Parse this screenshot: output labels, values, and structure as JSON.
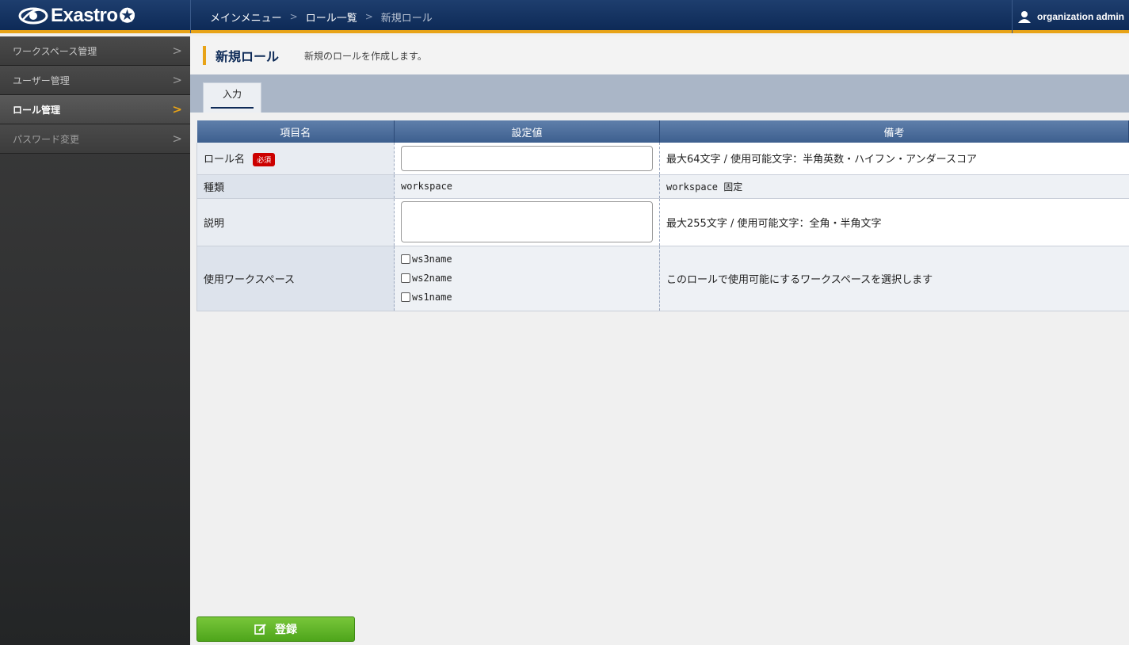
{
  "header": {
    "logo_text": "Exastro",
    "breadcrumb": [
      "メインメニュー",
      "ロール一覧",
      "新規ロール"
    ],
    "user_name": "organization admin"
  },
  "sidebar": {
    "items": [
      {
        "label": "ワークスペース管理",
        "state": "normal"
      },
      {
        "label": "ユーザー管理",
        "state": "normal"
      },
      {
        "label": "ロール管理",
        "state": "active"
      },
      {
        "label": "パスワード変更",
        "state": "disabled"
      }
    ]
  },
  "page": {
    "title": "新規ロール",
    "description": "新規のロールを作成します。",
    "tab_label": "入力"
  },
  "table": {
    "headers": [
      "項目名",
      "設定値",
      "備考"
    ],
    "rows": [
      {
        "label": "ロール名",
        "required_badge": "必須",
        "value": "",
        "note": "最大64文字 / 使用可能文字：半角英数・ハイフン・アンダースコア"
      },
      {
        "label": "種類",
        "value": "workspace",
        "note": "workspace 固定"
      },
      {
        "label": "説明",
        "value": "",
        "note": "最大255文字 / 使用可能文字：全角・半角文字"
      },
      {
        "label": "使用ワークスペース",
        "options": [
          "ws3name",
          "ws2name",
          "ws1name"
        ],
        "note": "このロールで使用可能にするワークスペースを選択します"
      }
    ]
  },
  "submit_label": "登録",
  "colors": {
    "header_bg": "#0d2a57",
    "accent": "#e8a317",
    "submit_green": "#5fb52a",
    "required_red": "#cc0000"
  }
}
